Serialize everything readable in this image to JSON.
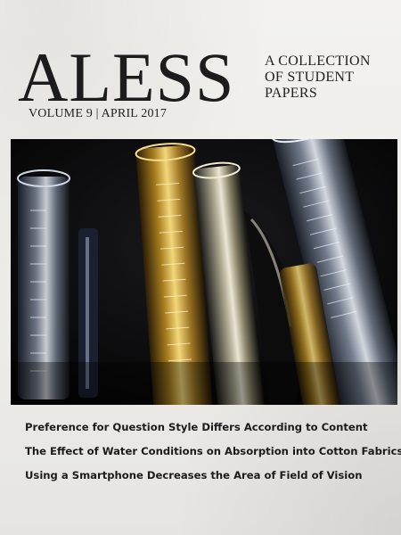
{
  "cover": {
    "masthead": "ALESS",
    "subtitle_lines": [
      "A COLLECTION",
      "OF STUDENT",
      "PAPERS"
    ],
    "issue_line": "VOLUME 9 | APRIL 2017"
  },
  "image": {
    "subject": "glass graduated cylinders in dark light",
    "background_color": "#070707",
    "accent_colors": [
      "#c9a23a",
      "#dfe6f2",
      "#8a6b2a"
    ]
  },
  "articles": [
    "Preference for Question Style Differs According to Content",
    "The Effect of Water Conditions on Absorption into Cotton Fabrics",
    "Using a Smartphone Decreases the Area of Field of Vision"
  ]
}
